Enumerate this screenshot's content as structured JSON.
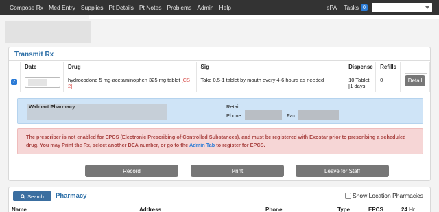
{
  "nav": {
    "items": [
      "Compose Rx",
      "Med Entry",
      "Supplies",
      "Pt Details",
      "Pt Notes",
      "Problems",
      "Admin",
      "Help"
    ],
    "epa": "ePA",
    "tasks": "Tasks",
    "tasks_count": "0"
  },
  "transmit": {
    "title": "Transmit Rx",
    "columns": [
      "Date",
      "Drug",
      "Sig",
      "Dispense",
      "Refills"
    ],
    "row": {
      "drug": "hydrocodone 5 mg-acetaminophen 325 mg tablet",
      "schedule": "[CS 2]",
      "sig": "Take 0.5-1 tablet by mouth every 4-6 hours as needed",
      "dispense_qty": "10 Tablet",
      "dispense_days": "[1 days]",
      "refills": "0",
      "detail_label": "Detail"
    },
    "pharmacy": {
      "name": "Walmart Pharmacy",
      "type": "Retail",
      "phone_label": "Phone:",
      "fax_label": "Fax:"
    },
    "alert": {
      "text_1": "The prescriber is not enabled for EPCS (Electronic Prescribing of Controlled Substances), and must be registered with Exostar prior to prescribing a scheduled drug. You may Print the Rx, select another DEA number, or go to the ",
      "link": "Admin Tab",
      "text_2": " to register for EPCS."
    },
    "buttons": {
      "record": "Record",
      "print": "Print",
      "leave": "Leave for Staff"
    }
  },
  "pharmacy_panel": {
    "search_label": "Search",
    "title": "Pharmacy",
    "show_location_label": "Show Location Pharmacies",
    "columns": [
      "Name",
      "Address",
      "Phone",
      "Type",
      "EPCS",
      "24 Hr"
    ]
  },
  "colors": {
    "nav_bg": "#333333",
    "accent": "#2d6fa7",
    "alert_bg": "#f6d6d6",
    "pharmacy_bg": "#cfe4f7"
  }
}
